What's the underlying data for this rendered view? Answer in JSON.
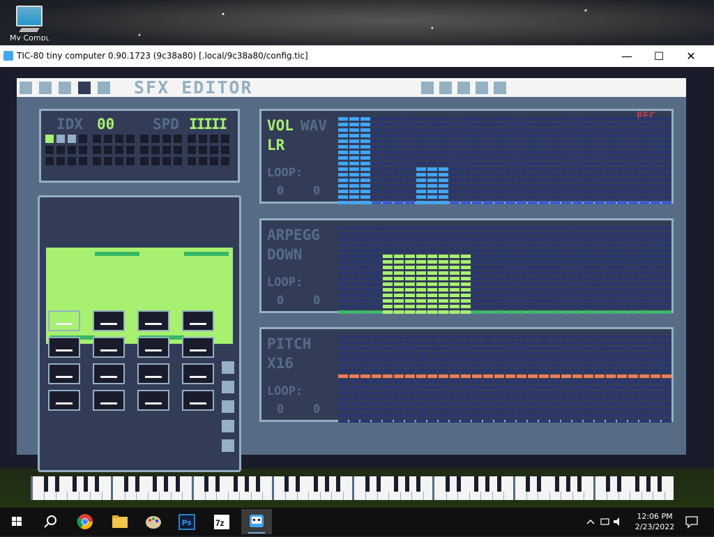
{
  "desktop": {
    "icon_label": "My Computer"
  },
  "window": {
    "title": "TIC-80 tiny computer 0.90.1723 (9c38a80) [.local/9c38a80/config.tic]",
    "controls": {
      "minimize": "—",
      "maximize": "☐",
      "close": "✕"
    }
  },
  "editor": {
    "heading": "SFX EDITOR",
    "idx_label": "IDX",
    "idx_value": "00",
    "spd_label": "SPD",
    "spd_value": "IIIII",
    "rec_label": "REC",
    "volume_panel": {
      "label1": "VOL",
      "label1_alt": "WAV",
      "label2": "LR",
      "loop_label": "LOOP:",
      "loop_start": "0",
      "loop_size": "0"
    },
    "arpeggio_panel": {
      "label1": "ARPEGG",
      "label2": "DOWN",
      "loop_label": "LOOP:",
      "loop_start": "0",
      "loop_size": "0"
    },
    "pitch_panel": {
      "label1": "PITCH",
      "label2": "X16",
      "loop_label": "LOOP:",
      "loop_start": "0",
      "loop_size": "0"
    },
    "volume_values": [
      15,
      15,
      15,
      0,
      0,
      0,
      0,
      6,
      6,
      6,
      0,
      0,
      0,
      0,
      0,
      0,
      0,
      0,
      0,
      0,
      0,
      0,
      0,
      0,
      0,
      0,
      0,
      0,
      0,
      0
    ],
    "arpeggio_values": [
      0,
      0,
      0,
      0,
      10,
      10,
      10,
      10,
      10,
      10,
      10,
      10,
      0,
      0,
      0,
      0,
      0,
      0,
      0,
      0,
      0,
      0,
      0,
      0,
      0,
      0,
      0,
      0,
      0,
      0
    ],
    "pitch_row": 7,
    "colors": {
      "volume": "#3b5dc9",
      "volume_lit": "#41a6f6",
      "arpeggio": "#38b764",
      "arpeggio_lit": "#a7f070",
      "pitch": "#ef7d57",
      "panel": "#333c57",
      "cell": "#29366f"
    }
  },
  "taskbar": {
    "time": "12:06 PM",
    "date": "2/23/2022",
    "apps": [
      "start-icon",
      "search-icon",
      "chrome-icon",
      "file-explorer-icon",
      "paint-icon",
      "photoshop-icon",
      "7zip-icon",
      "tic80-icon"
    ],
    "ps_label": "Ps",
    "7z_label": "7z"
  }
}
